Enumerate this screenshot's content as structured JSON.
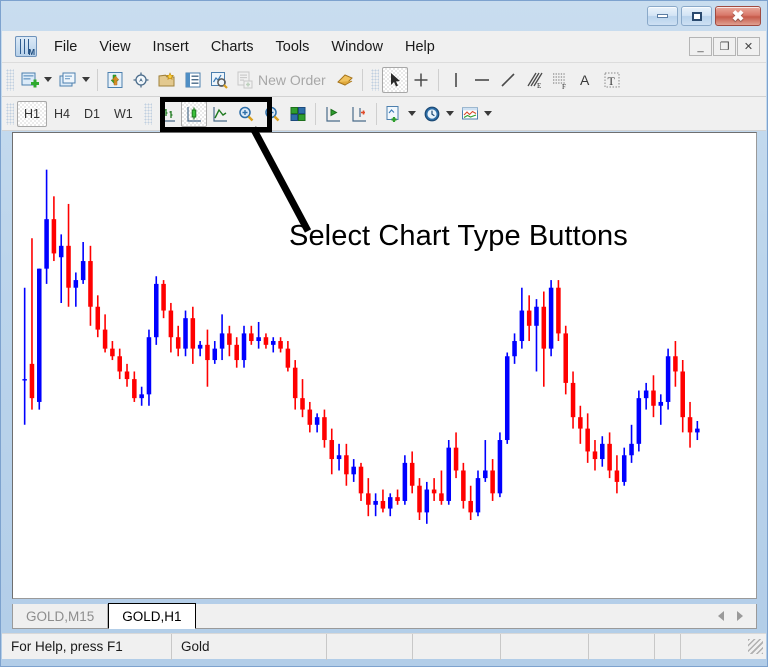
{
  "window": {
    "controls": {
      "minimize": "minimize-button",
      "maximize": "maximize-button",
      "close": "close-button"
    }
  },
  "menu": {
    "items": [
      "File",
      "View",
      "Insert",
      "Charts",
      "Tools",
      "Window",
      "Help"
    ],
    "mdi": {
      "minimize": "_",
      "restore": "❐",
      "close": "✕"
    }
  },
  "toolbar_main": {
    "new_chart": "new-chart-icon",
    "profiles": "profiles-icon",
    "market_watch": "market-watch-icon",
    "navigator": "navigator-icon",
    "terminal": "terminal-icon",
    "data_window": "data-window-icon",
    "strategy_tester": "strategy-tester-icon",
    "new_order_label": "New Order",
    "expert_advisors": "expert-advisors-icon",
    "cursor": "cursor-icon",
    "crosshair": "crosshair-icon",
    "vertical_line": "vertical-line-icon",
    "horizontal_line": "horizontal-line-icon",
    "trendline": "trendline-icon",
    "equidistant_channel": "equidistant-channel-icon",
    "fibonacci": "fibonacci-retracement-icon",
    "text": "text-icon",
    "text_label": "text-label-icon"
  },
  "toolbar_chart": {
    "timeframes": [
      {
        "label": "H1",
        "active": true
      },
      {
        "label": "H4",
        "active": false
      },
      {
        "label": "D1",
        "active": false
      },
      {
        "label": "W1",
        "active": false
      }
    ],
    "chart_types": [
      {
        "name": "bar-chart-type-button",
        "active": false
      },
      {
        "name": "candlestick-chart-type-button",
        "active": true
      },
      {
        "name": "line-chart-type-button",
        "active": false
      }
    ],
    "zoom_in": "zoom-in-icon",
    "zoom_out": "zoom-out-icon",
    "tile_windows": "tile-windows-icon",
    "auto_scroll": "auto-scroll-icon",
    "chart_shift": "chart-shift-icon",
    "indicators": "indicators-icon",
    "periods": "periods-icon",
    "templates": "templates-icon"
  },
  "annotation": {
    "text": "Select Chart Type Buttons"
  },
  "tabs": {
    "items": [
      {
        "label": "GOLD,M15",
        "active": false
      },
      {
        "label": "GOLD,H1",
        "active": true
      }
    ],
    "scroll_left": "tab-scroll-left-icon",
    "scroll_right": "tab-scroll-right-icon"
  },
  "status_bar": {
    "help_text": "For Help, press F1",
    "symbol": "Gold",
    "cell3": "",
    "cell4": "",
    "cell5": "",
    "cell6": "",
    "cell7": ""
  },
  "colors": {
    "bull_candle": "#0000FF",
    "bear_candle": "#FF0000",
    "chart_background": "#FFFFFF",
    "annotation": "#000000"
  },
  "chart_data": {
    "type": "candlestick",
    "title": "GOLD,H1",
    "symbol": "Gold",
    "timeframe": "H1",
    "xlabel": "",
    "ylabel": "",
    "grid": false,
    "legend": "none",
    "ylim": [
      1,
      100
    ],
    "bull_color": "#0000FF",
    "bear_color": "#FF0000",
    "note": "Values are relative chart units read off pixel positions; higher = higher price.",
    "candles": [
      {
        "i": 0,
        "o": 38,
        "h": 62,
        "l": 26,
        "c": 38
      },
      {
        "i": 1,
        "o": 42,
        "h": 75,
        "l": 30,
        "c": 33
      },
      {
        "i": 2,
        "o": 32,
        "h": 67,
        "l": 30,
        "c": 67
      },
      {
        "i": 3,
        "o": 67,
        "h": 93,
        "l": 63,
        "c": 80
      },
      {
        "i": 4,
        "o": 80,
        "h": 86,
        "l": 69,
        "c": 71
      },
      {
        "i": 5,
        "o": 70,
        "h": 76,
        "l": 58,
        "c": 73
      },
      {
        "i": 6,
        "o": 73,
        "h": 84,
        "l": 57,
        "c": 62
      },
      {
        "i": 7,
        "o": 62,
        "h": 66,
        "l": 57,
        "c": 64
      },
      {
        "i": 8,
        "o": 64,
        "h": 74,
        "l": 63,
        "c": 69
      },
      {
        "i": 9,
        "o": 69,
        "h": 73,
        "l": 52,
        "c": 57
      },
      {
        "i": 10,
        "o": 57,
        "h": 60,
        "l": 49,
        "c": 51
      },
      {
        "i": 11,
        "o": 51,
        "h": 55,
        "l": 45,
        "c": 46
      },
      {
        "i": 12,
        "o": 46,
        "h": 48,
        "l": 43,
        "c": 44
      },
      {
        "i": 13,
        "o": 44,
        "h": 46,
        "l": 38,
        "c": 40
      },
      {
        "i": 14,
        "o": 40,
        "h": 42,
        "l": 36,
        "c": 38
      },
      {
        "i": 15,
        "o": 38,
        "h": 40,
        "l": 32,
        "c": 33
      },
      {
        "i": 16,
        "o": 33,
        "h": 36,
        "l": 31,
        "c": 34
      },
      {
        "i": 17,
        "o": 34,
        "h": 51,
        "l": 31,
        "c": 49
      },
      {
        "i": 18,
        "o": 49,
        "h": 65,
        "l": 47,
        "c": 63
      },
      {
        "i": 19,
        "o": 63,
        "h": 64,
        "l": 54,
        "c": 56
      },
      {
        "i": 20,
        "o": 56,
        "h": 58,
        "l": 45,
        "c": 49
      },
      {
        "i": 21,
        "o": 49,
        "h": 52,
        "l": 44,
        "c": 46
      },
      {
        "i": 22,
        "o": 46,
        "h": 56,
        "l": 44,
        "c": 54
      },
      {
        "i": 23,
        "o": 54,
        "h": 57,
        "l": 42,
        "c": 46
      },
      {
        "i": 24,
        "o": 46,
        "h": 48,
        "l": 44,
        "c": 47
      },
      {
        "i": 25,
        "o": 47,
        "h": 51,
        "l": 36,
        "c": 43
      },
      {
        "i": 26,
        "o": 43,
        "h": 48,
        "l": 42,
        "c": 46
      },
      {
        "i": 27,
        "o": 46,
        "h": 55,
        "l": 43,
        "c": 50
      },
      {
        "i": 28,
        "o": 50,
        "h": 52,
        "l": 44,
        "c": 47
      },
      {
        "i": 29,
        "o": 47,
        "h": 49,
        "l": 41,
        "c": 43
      },
      {
        "i": 30,
        "o": 43,
        "h": 52,
        "l": 41,
        "c": 50
      },
      {
        "i": 31,
        "o": 50,
        "h": 52,
        "l": 47,
        "c": 48
      },
      {
        "i": 32,
        "o": 48,
        "h": 53,
        "l": 46,
        "c": 49
      },
      {
        "i": 33,
        "o": 49,
        "h": 50,
        "l": 46,
        "c": 47
      },
      {
        "i": 34,
        "o": 47,
        "h": 49,
        "l": 45,
        "c": 48
      },
      {
        "i": 35,
        "o": 48,
        "h": 49,
        "l": 45,
        "c": 46
      },
      {
        "i": 36,
        "o": 46,
        "h": 48,
        "l": 40,
        "c": 41
      },
      {
        "i": 37,
        "o": 41,
        "h": 43,
        "l": 30,
        "c": 33
      },
      {
        "i": 38,
        "o": 33,
        "h": 38,
        "l": 28,
        "c": 30
      },
      {
        "i": 39,
        "o": 30,
        "h": 32,
        "l": 24,
        "c": 26
      },
      {
        "i": 40,
        "o": 26,
        "h": 29,
        "l": 24,
        "c": 28
      },
      {
        "i": 41,
        "o": 28,
        "h": 30,
        "l": 20,
        "c": 22
      },
      {
        "i": 42,
        "o": 22,
        "h": 25,
        "l": 13,
        "c": 17
      },
      {
        "i": 43,
        "o": 17,
        "h": 21,
        "l": 14,
        "c": 18
      },
      {
        "i": 44,
        "o": 18,
        "h": 21,
        "l": 10,
        "c": 13
      },
      {
        "i": 45,
        "o": 13,
        "h": 17,
        "l": 11,
        "c": 15
      },
      {
        "i": 46,
        "o": 15,
        "h": 16,
        "l": 6,
        "c": 8
      },
      {
        "i": 47,
        "o": 8,
        "h": 12,
        "l": 2,
        "c": 5
      },
      {
        "i": 48,
        "o": 5,
        "h": 8,
        "l": 2,
        "c": 6
      },
      {
        "i": 49,
        "o": 6,
        "h": 9,
        "l": 3,
        "c": 4
      },
      {
        "i": 50,
        "o": 4,
        "h": 8,
        "l": 2,
        "c": 7
      },
      {
        "i": 51,
        "o": 7,
        "h": 9,
        "l": 5,
        "c": 6
      },
      {
        "i": 52,
        "o": 6,
        "h": 18,
        "l": 5,
        "c": 16
      },
      {
        "i": 53,
        "o": 16,
        "h": 19,
        "l": 8,
        "c": 10
      },
      {
        "i": 54,
        "o": 10,
        "h": 12,
        "l": 1,
        "c": 3
      },
      {
        "i": 55,
        "o": 3,
        "h": 11,
        "l": 0,
        "c": 9
      },
      {
        "i": 56,
        "o": 9,
        "h": 12,
        "l": 6,
        "c": 8
      },
      {
        "i": 57,
        "o": 8,
        "h": 14,
        "l": 5,
        "c": 6
      },
      {
        "i": 58,
        "o": 6,
        "h": 22,
        "l": 5,
        "c": 20
      },
      {
        "i": 59,
        "o": 20,
        "h": 24,
        "l": 12,
        "c": 14
      },
      {
        "i": 60,
        "o": 14,
        "h": 16,
        "l": 4,
        "c": 6
      },
      {
        "i": 61,
        "o": 6,
        "h": 10,
        "l": 1,
        "c": 3
      },
      {
        "i": 62,
        "o": 3,
        "h": 14,
        "l": 2,
        "c": 12
      },
      {
        "i": 63,
        "o": 12,
        "h": 22,
        "l": 11,
        "c": 14
      },
      {
        "i": 64,
        "o": 14,
        "h": 17,
        "l": 6,
        "c": 8
      },
      {
        "i": 65,
        "o": 8,
        "h": 24,
        "l": 7,
        "c": 22
      },
      {
        "i": 66,
        "o": 22,
        "h": 45,
        "l": 21,
        "c": 44
      },
      {
        "i": 67,
        "o": 44,
        "h": 50,
        "l": 42,
        "c": 48
      },
      {
        "i": 68,
        "o": 48,
        "h": 62,
        "l": 46,
        "c": 56
      },
      {
        "i": 69,
        "o": 56,
        "h": 60,
        "l": 48,
        "c": 52
      },
      {
        "i": 70,
        "o": 52,
        "h": 59,
        "l": 40,
        "c": 57
      },
      {
        "i": 71,
        "o": 57,
        "h": 61,
        "l": 36,
        "c": 46
      },
      {
        "i": 72,
        "o": 46,
        "h": 64,
        "l": 44,
        "c": 62
      },
      {
        "i": 73,
        "o": 62,
        "h": 64,
        "l": 48,
        "c": 50
      },
      {
        "i": 74,
        "o": 50,
        "h": 52,
        "l": 34,
        "c": 37
      },
      {
        "i": 75,
        "o": 37,
        "h": 40,
        "l": 25,
        "c": 28
      },
      {
        "i": 76,
        "o": 28,
        "h": 31,
        "l": 21,
        "c": 25
      },
      {
        "i": 77,
        "o": 25,
        "h": 29,
        "l": 16,
        "c": 19
      },
      {
        "i": 78,
        "o": 19,
        "h": 22,
        "l": 14,
        "c": 17
      },
      {
        "i": 79,
        "o": 17,
        "h": 23,
        "l": 15,
        "c": 21
      },
      {
        "i": 80,
        "o": 21,
        "h": 24,
        "l": 12,
        "c": 14
      },
      {
        "i": 81,
        "o": 14,
        "h": 18,
        "l": 8,
        "c": 11
      },
      {
        "i": 82,
        "o": 11,
        "h": 20,
        "l": 10,
        "c": 18
      },
      {
        "i": 83,
        "o": 18,
        "h": 26,
        "l": 16,
        "c": 21
      },
      {
        "i": 84,
        "o": 21,
        "h": 35,
        "l": 19,
        "c": 33
      },
      {
        "i": 85,
        "o": 33,
        "h": 37,
        "l": 30,
        "c": 35
      },
      {
        "i": 86,
        "o": 35,
        "h": 39,
        "l": 28,
        "c": 31
      },
      {
        "i": 87,
        "o": 31,
        "h": 34,
        "l": 26,
        "c": 32
      },
      {
        "i": 88,
        "o": 32,
        "h": 46,
        "l": 30,
        "c": 44
      },
      {
        "i": 89,
        "o": 44,
        "h": 48,
        "l": 36,
        "c": 40
      },
      {
        "i": 90,
        "o": 40,
        "h": 43,
        "l": 24,
        "c": 28
      },
      {
        "i": 91,
        "o": 28,
        "h": 32,
        "l": 20,
        "c": 24
      },
      {
        "i": 92,
        "o": 24,
        "h": 27,
        "l": 22,
        "c": 25
      }
    ]
  }
}
